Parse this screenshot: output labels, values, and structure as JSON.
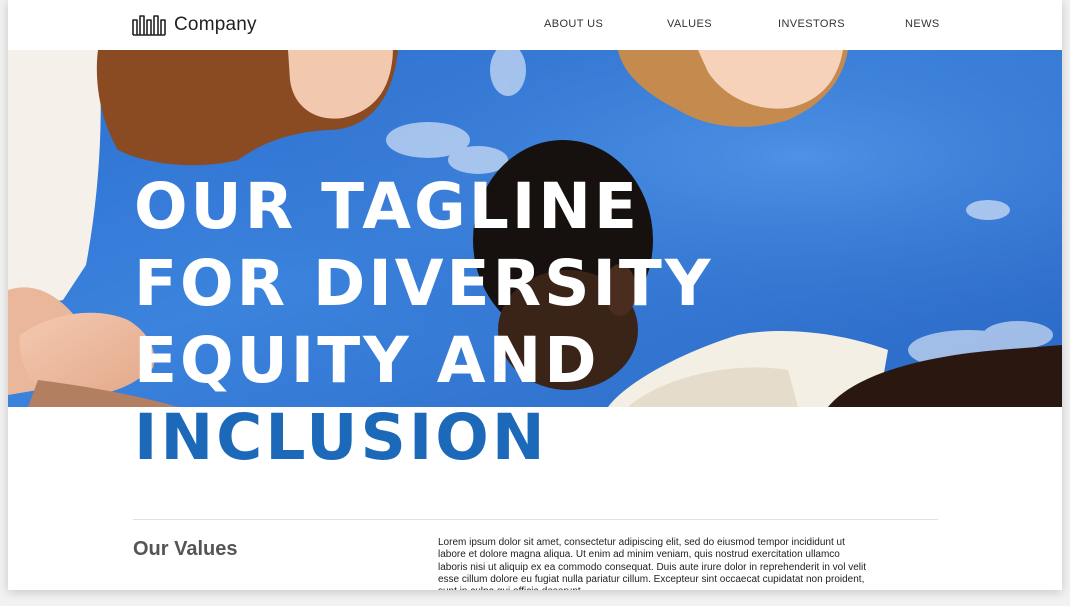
{
  "brand": {
    "name": "Company",
    "logo_icon": "city-skyline-icon"
  },
  "nav": {
    "items": [
      {
        "label": "ABOUT US"
      },
      {
        "label": "VALUES"
      },
      {
        "label": "INVESTORS"
      },
      {
        "label": "NEWS"
      }
    ]
  },
  "hero": {
    "image": "people-huddle-under-sky-photo",
    "headline_lines": [
      "OUR TAGLINE",
      "FOR DIVERSITY",
      "EQUITY AND",
      "INCLUSION"
    ],
    "headline_color": "#ffffff",
    "accent_color": "#1b69b8",
    "sky_color": "#3b83dd"
  },
  "values_section": {
    "title": "Our Values",
    "body": "Lorem ipsum dolor sit amet, consectetur adipiscing elit, sed do eiusmod tempor incididunt ut labore et dolore magna aliqua. Ut enim ad minim veniam, quis nostrud exercitation ullamco laboris nisi ut aliquip ex ea commodo consequat. Duis aute irure dolor in reprehenderit in vol velit esse cillum dolore eu fugiat nulla pariatur cillum. Excepteur sint occaecat cupidatat non proident, sunt in culpa qui officia deserunt"
  }
}
